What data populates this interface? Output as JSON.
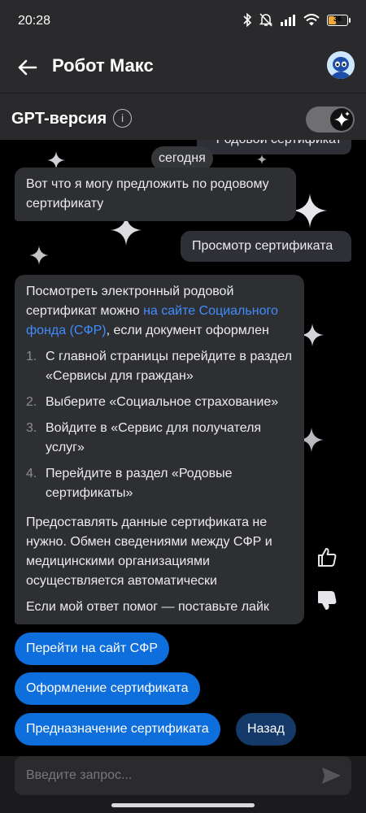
{
  "status_bar": {
    "time": "20:28",
    "battery_level": "36",
    "icons": [
      "bluetooth-icon",
      "bell-muted-icon",
      "signal-icon",
      "wifi-icon",
      "battery-icon"
    ]
  },
  "app_bar": {
    "title": "Робот Макс",
    "back_icon": "arrow-left-icon",
    "avatar_icon": "robot-avatar-icon"
  },
  "gpt": {
    "label": "GPT-версия",
    "info_icon": "info-icon",
    "toggle_on": true
  },
  "chat": {
    "previous_user_message": "Родовой сертификат",
    "date_label": "сегодня",
    "bot_message_1": "Вот что я могу предложить по родовому сертификату",
    "user_message": "Просмотр сертификата",
    "bot_message_2": {
      "intro_before_link": "Посмотреть электронный родовой сертификат можно ",
      "link_text": "на сайте Социального фонда (СФР)",
      "intro_after_link": ", если документ оформлен",
      "steps": [
        {
          "num": "1.",
          "text": "С главной страницы перейдите в раздел «Сервисы для граждан»"
        },
        {
          "num": "2.",
          "text": "Выберите «Социальное страхование»"
        },
        {
          "num": "3.",
          "text": "Войдите в «Сервис для получателя услуг»"
        },
        {
          "num": "4.",
          "text": "Перейдите в раздел «Родовые сертификаты»"
        }
      ],
      "note": "Предоставлять данные сертификата не нужно. Обмен сведениями между СФР и медицинскими организациями осуществляется автоматически",
      "footer": "Если мой ответ помог — поставьте лайк"
    },
    "reactions": {
      "like_icon": "thumbs-up-icon",
      "dislike_icon": "thumbs-down-icon"
    }
  },
  "quick_replies": [
    "Перейти на сайт СФР",
    "Оформление сертификата",
    "Предназначение сертификата",
    "Назад"
  ],
  "input": {
    "placeholder": "Введите запрос...",
    "send_icon": "send-icon"
  },
  "colors": {
    "accent": "#0d6edc",
    "link": "#3f8dff",
    "battery": "#f2a93b"
  }
}
